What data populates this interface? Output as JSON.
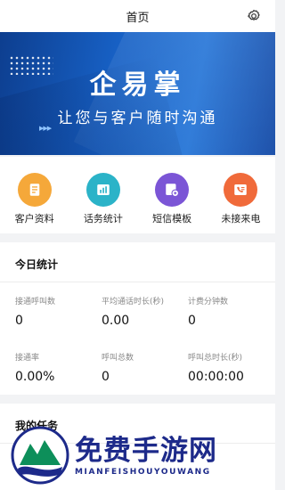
{
  "header": {
    "title": "首页",
    "settings_icon": "gear-icon"
  },
  "banner": {
    "brand": "企易掌",
    "slogan": "让您与客户随时沟通"
  },
  "quick_actions": [
    {
      "label": "客户资料",
      "icon": "document-icon",
      "color": "#f5a83a"
    },
    {
      "label": "话务统计",
      "icon": "bar-chart-icon",
      "color": "#2bb3c8"
    },
    {
      "label": "短信模板",
      "icon": "sms-template-icon",
      "color": "#7b55d6"
    },
    {
      "label": "未接来电",
      "icon": "missed-call-icon",
      "color": "#f06a3a"
    }
  ],
  "today_stats": {
    "title": "今日统计",
    "items": [
      {
        "label": "接通呼叫数",
        "value": "0"
      },
      {
        "label": "平均通话时长(秒)",
        "value": "0.00"
      },
      {
        "label": "计费分钟数",
        "value": "0"
      },
      {
        "label": "接通率",
        "value": "0.00%"
      },
      {
        "label": "呼叫总数",
        "value": "0"
      },
      {
        "label": "呼叫总时长(秒)",
        "value": "00:00:00"
      }
    ]
  },
  "tasks": {
    "title": "我的任务"
  },
  "watermark": {
    "cn": "免费手游网",
    "en": "MIANFEISHOUYOUWANG"
  }
}
